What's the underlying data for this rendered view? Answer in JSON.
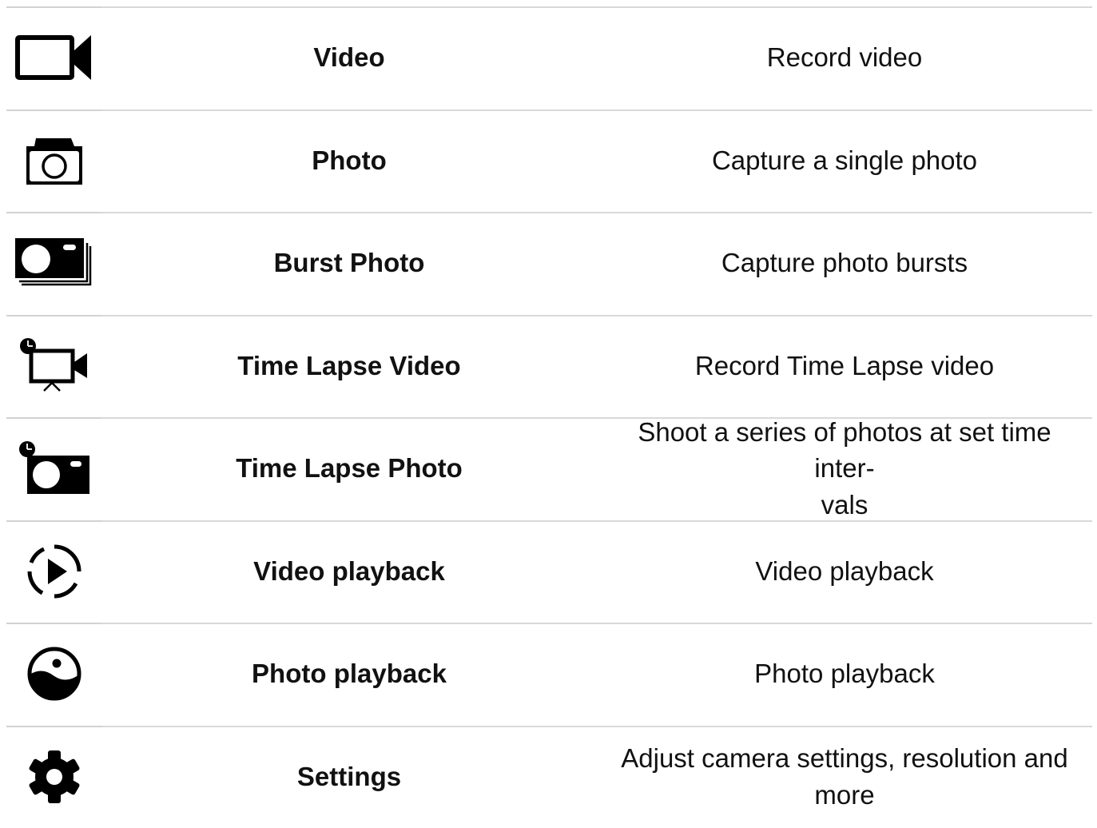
{
  "rows": [
    {
      "icon": "video-camera-icon",
      "name": "Video",
      "description": "Record video"
    },
    {
      "icon": "photo-camera-icon",
      "name": "Photo",
      "description": "Capture a single photo"
    },
    {
      "icon": "burst-photo-icon",
      "name": "Burst Photo",
      "description": "Capture photo bursts"
    },
    {
      "icon": "time-lapse-video-icon",
      "name": "Time Lapse Video",
      "description": "Record Time Lapse video"
    },
    {
      "icon": "time-lapse-photo-icon",
      "name": "Time Lapse Photo",
      "description": "Shoot a series of photos at set time inter-\nvals"
    },
    {
      "icon": "video-playback-icon",
      "name": "Video playback",
      "description": "Video playback"
    },
    {
      "icon": "photo-playback-icon",
      "name": "Photo playback",
      "description": "Photo playback"
    },
    {
      "icon": "settings-gear-icon",
      "name": "Settings",
      "description": "Adjust camera settings, resolution and more"
    }
  ],
  "colors": {
    "text": "#111111",
    "icon": "#000000",
    "rule": "#d9d9d9",
    "background": "#ffffff"
  }
}
